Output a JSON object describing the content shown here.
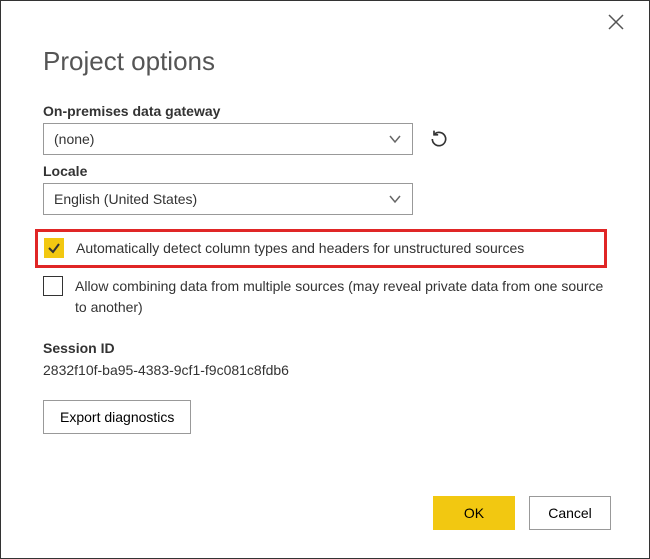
{
  "title": "Project options",
  "gateway": {
    "label": "On-premises data gateway",
    "value": "(none)"
  },
  "locale": {
    "label": "Locale",
    "value": "English (United States)"
  },
  "options": {
    "auto_detect": {
      "checked": true,
      "label": "Automatically detect column types and headers for unstructured sources"
    },
    "allow_combine": {
      "checked": false,
      "label": "Allow combining data from multiple sources (may reveal private data from one source to another)"
    }
  },
  "session": {
    "label": "Session ID",
    "value": "2832f10f-ba95-4383-9cf1-f9c081c8fdb6"
  },
  "buttons": {
    "export": "Export diagnostics",
    "ok": "OK",
    "cancel": "Cancel"
  }
}
